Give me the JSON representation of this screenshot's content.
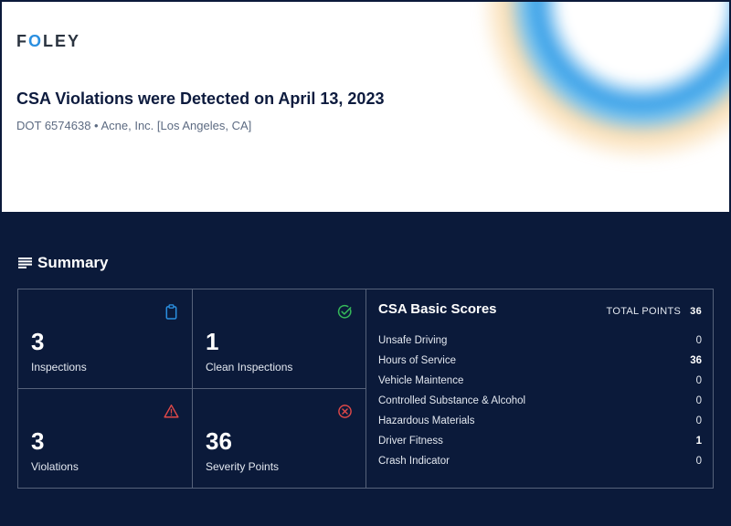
{
  "header": {
    "logo_first": "F",
    "logo_o": "O",
    "logo_rest": "LEY",
    "title": "CSA Violations were Detected on April 13, 2023",
    "subtitle": "DOT 6574638 • Acne, Inc. [Los Angeles, CA]"
  },
  "summary": {
    "title": "Summary",
    "icon": "list-lines-icon",
    "stats": [
      {
        "value": "3",
        "label": "Inspections",
        "icon": "clipboard-icon",
        "color": "#2b8fe0"
      },
      {
        "value": "1",
        "label": "Clean Inspections",
        "icon": "check-circle-icon",
        "color": "#35b85a"
      },
      {
        "value": "3",
        "label": "Violations",
        "icon": "warning-triangle-icon",
        "color": "#e04848"
      },
      {
        "value": "36",
        "label": "Severity Points",
        "icon": "x-circle-icon",
        "color": "#e04848"
      }
    ]
  },
  "scores": {
    "title": "CSA Basic Scores",
    "total_label": "TOTAL POINTS",
    "total_value": "36",
    "rows": [
      {
        "label": "Unsafe Driving",
        "value": "0"
      },
      {
        "label": "Hours of Service",
        "value": "36"
      },
      {
        "label": "Vehicle Maintence",
        "value": "0"
      },
      {
        "label": "Controlled Substance & Alcohol",
        "value": "0"
      },
      {
        "label": "Hazardous Materials",
        "value": "0"
      },
      {
        "label": "Driver Fitness",
        "value": "1"
      },
      {
        "label": "Crash Indicator",
        "value": "0"
      }
    ]
  },
  "colors": {
    "background_dark": "#0b1a3a",
    "accent_blue": "#2b8fe0",
    "grid_border": "#56627a"
  }
}
